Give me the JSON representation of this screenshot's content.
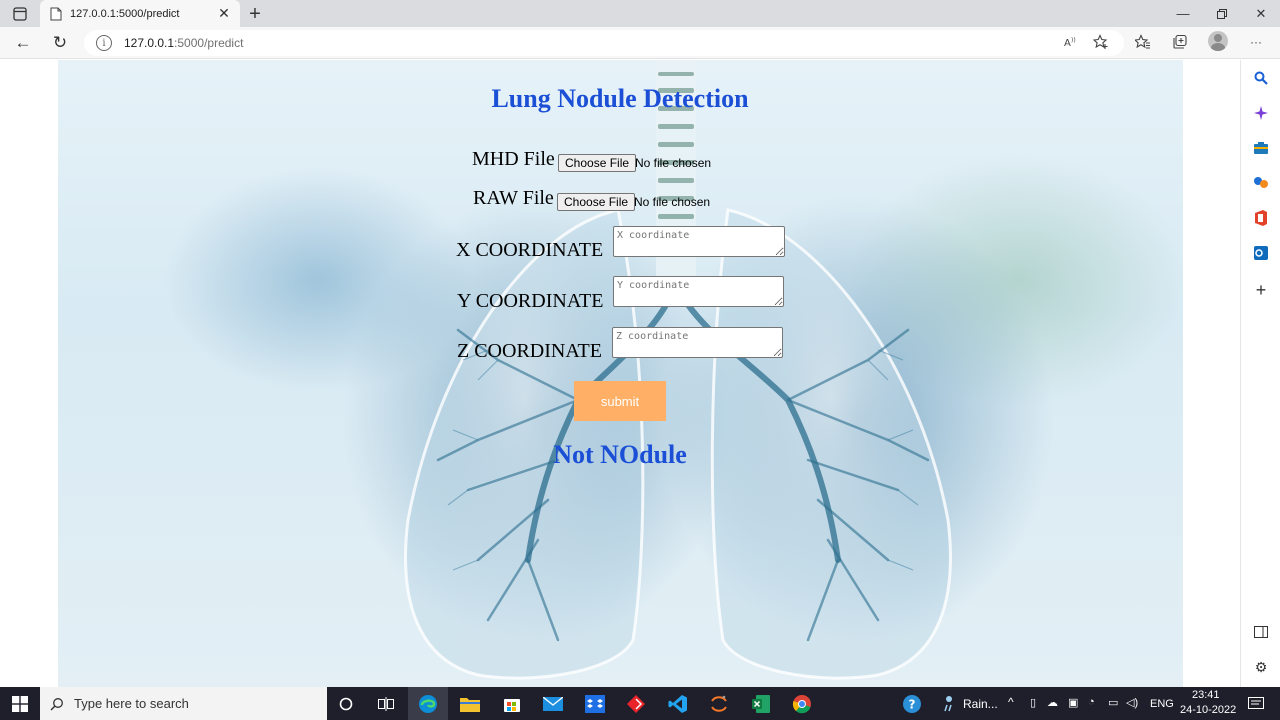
{
  "browser": {
    "tab_title": "127.0.0.1:5000/predict",
    "url_host": "127.0.0.1",
    "url_path": ":5000/predict"
  },
  "page": {
    "title": "Lung Nodule Detection",
    "mhd_label": "MHD File",
    "raw_label": "RAW File",
    "choose_file_label": "Choose File",
    "no_file_text": "No file chosen",
    "x_label": "X COORDINATE",
    "y_label": "Y COORDINATE",
    "z_label": "Z COORDINATE",
    "x_placeholder": "X coordinate",
    "y_placeholder": "Y coordinate",
    "z_placeholder": "Z coordinate",
    "submit_label": "submit",
    "result_text": "Not NOdule"
  },
  "taskbar": {
    "search_placeholder": "Type here to search",
    "weather_text": "Rain...",
    "language": "ENG",
    "time": "23:41",
    "date": "24-10-2022"
  },
  "colors": {
    "title_blue": "#1a4fd6",
    "submit_orange": "#ffb066",
    "taskbar_bg": "#1e1f2b"
  }
}
